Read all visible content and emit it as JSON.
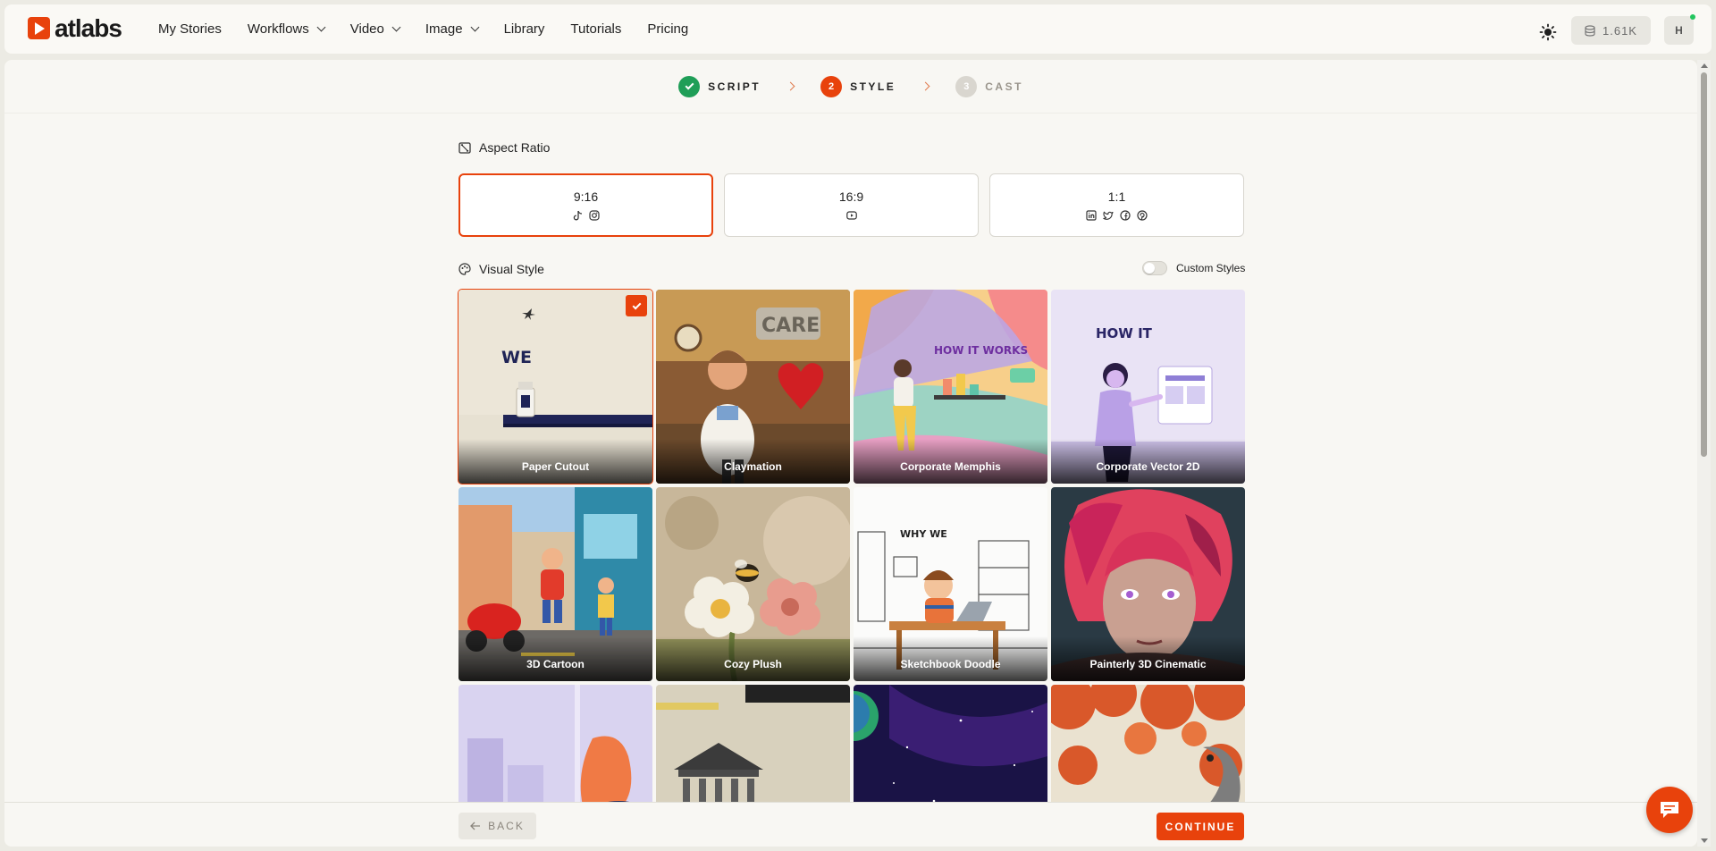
{
  "brand": {
    "name": "atlabs",
    "accent": "#e8420c"
  },
  "nav": {
    "items": [
      {
        "label": "My Stories",
        "dropdown": false
      },
      {
        "label": "Workflows",
        "dropdown": true
      },
      {
        "label": "Video",
        "dropdown": true
      },
      {
        "label": "Image",
        "dropdown": true
      },
      {
        "label": "Library",
        "dropdown": false
      },
      {
        "label": "Tutorials",
        "dropdown": false
      },
      {
        "label": "Pricing",
        "dropdown": false
      }
    ],
    "credits": "1.61K",
    "avatar": "H"
  },
  "stepper": {
    "steps": [
      {
        "num": "1",
        "label": "SCRIPT",
        "state": "done"
      },
      {
        "num": "2",
        "label": "STYLE",
        "state": "active"
      },
      {
        "num": "3",
        "label": "CAST",
        "state": "todo"
      }
    ]
  },
  "aspect": {
    "title": "Aspect Ratio",
    "options": [
      {
        "label": "9:16",
        "icons": [
          "tiktok-icon",
          "instagram-icon"
        ],
        "selected": true
      },
      {
        "label": "16:9",
        "icons": [
          "youtube-icon"
        ],
        "selected": false
      },
      {
        "label": "1:1",
        "icons": [
          "linkedin-icon",
          "twitter-icon",
          "facebook-icon",
          "pinterest-icon"
        ],
        "selected": false
      }
    ]
  },
  "visual": {
    "title": "Visual Style",
    "custom_styles_label": "Custom Styles",
    "custom_styles_on": false,
    "styles": [
      {
        "label": "Paper Cutout",
        "selected": true,
        "art": "paper"
      },
      {
        "label": "Claymation",
        "selected": false,
        "art": "clay"
      },
      {
        "label": "Corporate Memphis",
        "selected": false,
        "art": "memphis"
      },
      {
        "label": "Corporate Vector 2D",
        "selected": false,
        "art": "vector"
      },
      {
        "label": "3D Cartoon",
        "selected": false,
        "art": "cartoon"
      },
      {
        "label": "Cozy Plush",
        "selected": false,
        "art": "plush"
      },
      {
        "label": "Sketchbook Doodle",
        "selected": false,
        "art": "sketch"
      },
      {
        "label": "Painterly 3D Cinematic",
        "selected": false,
        "art": "painterly"
      },
      {
        "label": "",
        "selected": false,
        "art": "flatlilac"
      },
      {
        "label": "",
        "selected": false,
        "art": "vintage"
      },
      {
        "label": "",
        "selected": false,
        "art": "space"
      },
      {
        "label": "",
        "selected": false,
        "art": "dragon"
      }
    ],
    "art_text": {
      "paper": "WE",
      "clay": "CARE",
      "memphis": "HOW IT WORKS",
      "vector": "HOW IT",
      "sketch": "WHY WE"
    }
  },
  "footer": {
    "back_label": "BACK",
    "continue_label": "CONTINUE"
  }
}
